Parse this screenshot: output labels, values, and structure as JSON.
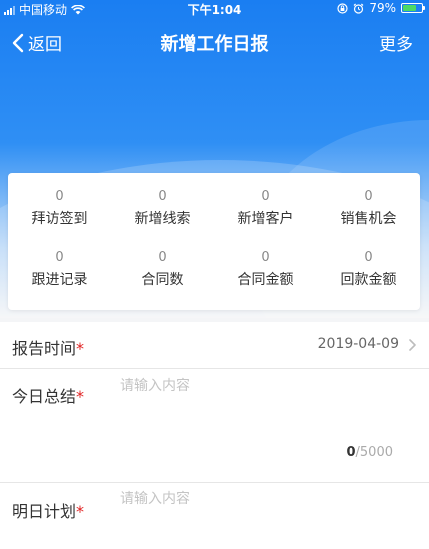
{
  "status_bar": {
    "carrier": "中国移动",
    "time": "下午1:04",
    "battery": "79%",
    "battery_level": 0.79
  },
  "nav": {
    "back_label": "返回",
    "title": "新增工作日报",
    "more_label": "更多"
  },
  "stats": [
    {
      "value": "0",
      "label": "拜访签到"
    },
    {
      "value": "0",
      "label": "新增线索"
    },
    {
      "value": "0",
      "label": "新增客户"
    },
    {
      "value": "0",
      "label": "销售机会"
    },
    {
      "value": "0",
      "label": "跟进记录"
    },
    {
      "value": "0",
      "label": "合同数"
    },
    {
      "value": "0",
      "label": "合同金额"
    },
    {
      "value": "0",
      "label": "回款金额"
    }
  ],
  "form": {
    "report_time": {
      "label": "报告时间",
      "required_mark": "*",
      "value": "2019-04-09"
    },
    "today_summary": {
      "label": "今日总结",
      "required_mark": "*",
      "placeholder": "请输入内容",
      "count": "0",
      "max": "/5000"
    },
    "tomorrow_plan": {
      "label": "明日计划",
      "required_mark": "*",
      "placeholder": "请输入内容"
    }
  },
  "colors": {
    "primary": "#1a7ef2",
    "required": "#e02020",
    "battery": "#4cd964"
  }
}
